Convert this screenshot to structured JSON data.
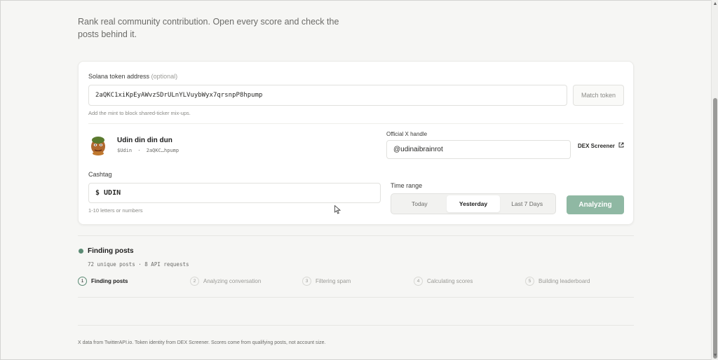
{
  "intro": {
    "text": "Rank real community contribution. Open every score and check the posts behind it."
  },
  "form": {
    "token_address": {
      "label": "Solana token address",
      "optional": "(optional)",
      "value": "2aQKC1xiKpEyAWvzSDrULnYLVuybWyx7qrsnpP8hpump",
      "hint": "Add the mint to block shared-ticker mix-ups.",
      "match_button": "Match token"
    },
    "token": {
      "name": "Udin din din dun",
      "symbol": "$Udin",
      "separator": "·",
      "short_address": "2aQKC…hpump"
    },
    "x_handle": {
      "label": "Official X handle",
      "value": "@udinaibrainrot"
    },
    "dex_link": {
      "label": "DEX Screener",
      "icon": "external-link-icon"
    },
    "cashtag": {
      "label": "Cashtag",
      "prefix": "$",
      "value": "UDIN",
      "hint": "1-10 letters or numbers"
    },
    "time_range": {
      "label": "Time range",
      "options": [
        "Today",
        "Yesterday",
        "Last 7 Days"
      ],
      "selected": "Yesterday"
    },
    "analyze_button": {
      "label": "Analyzing",
      "color": "#8fb8a3"
    }
  },
  "status": {
    "title": "Finding posts",
    "meta": "72 unique posts · 8 API requests",
    "steps": [
      {
        "num": "1",
        "label": "Finding posts"
      },
      {
        "num": "2",
        "label": "Analyzing conversation"
      },
      {
        "num": "3",
        "label": "Filtering spam"
      },
      {
        "num": "4",
        "label": "Calculating scores"
      },
      {
        "num": "5",
        "label": "Building leaderboard"
      }
    ],
    "active_step": "1",
    "accent_color": "#5b8a74"
  },
  "footer": {
    "text": "X data from TwitterAPI.io. Token identity from DEX Screener. Scores come from qualifying posts, not account size."
  }
}
